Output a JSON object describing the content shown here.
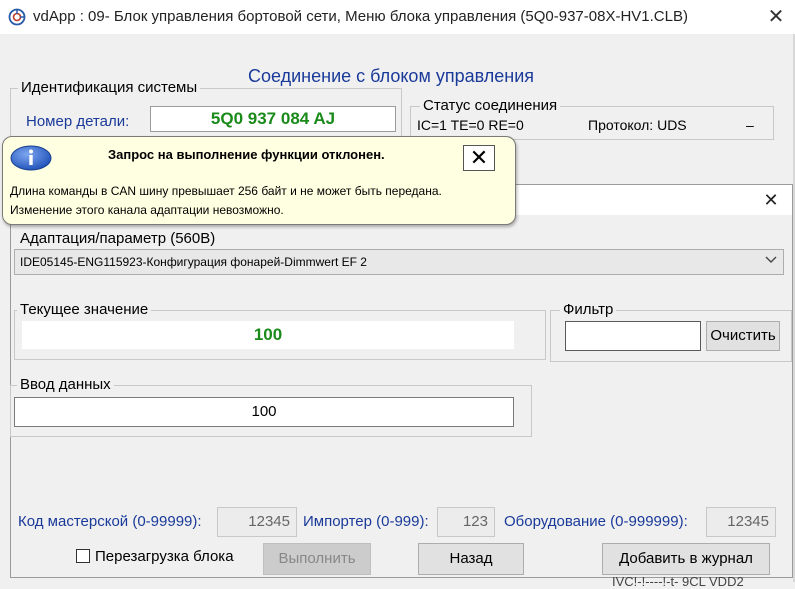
{
  "main_window": {
    "title": "vdApp : 09- Блок управления бортовой сети,  Меню блока управления (5Q0-937-08X-HV1.CLB)",
    "close_glyph": "✕",
    "icon": "app-logo-icon",
    "heading": "Соединение с блоком управления",
    "system_id": {
      "group_label": "Идентификация системы",
      "part_label": "Номер детали:",
      "part_value": "5Q0 937 084 AJ"
    },
    "connection_status": {
      "group_label": "Статус соединения",
      "status": "IC=1  TE=0   RE=0",
      "protocol": "Протокол: UDS",
      "dash": "–"
    }
  },
  "tooltip": {
    "icon": "info-icon",
    "title": "Запрос на выполнение функции отклонен.",
    "close_glyph": "✕",
    "line1": "Длина команды в CAN шину превышает 256 байт и не может быть передана.",
    "line2": "Изменение этого канала адаптации невозможно."
  },
  "adaptation_dialog": {
    "close_glyph": "✕",
    "adaptation_label": "Адаптация/параметр (560B)",
    "adaptation_selected": "IDE05145-ENG115923-Конфигурация фонарей-Dimmwert EF 2",
    "current_value_label": "Текущее значение",
    "current_value": "100",
    "filter_label": "Фильтр",
    "filter_value": "",
    "clear_button": "Очистить",
    "input_label": "Ввод данных",
    "input_value": "100",
    "master_code_label": "Код мастерской (0-99999):",
    "master_code_value": "12345",
    "importer_label": "Импортер (0-999):",
    "importer_value": "123",
    "equipment_label": "Оборудование (0-999999):",
    "equipment_value": "12345",
    "reboot_label": "Перезагрузка блока",
    "reboot_checked": false,
    "execute_button": "Выполнить",
    "back_button": "Назад",
    "journal_button": "Добавить в журнал",
    "footer_clipped": "IVC!-!----!-t- 9CL VDD2"
  },
  "colors": {
    "label_blue": "#1a3a9a",
    "value_green": "#1a8a1a",
    "tooltip_bg": "#ffffe1"
  }
}
